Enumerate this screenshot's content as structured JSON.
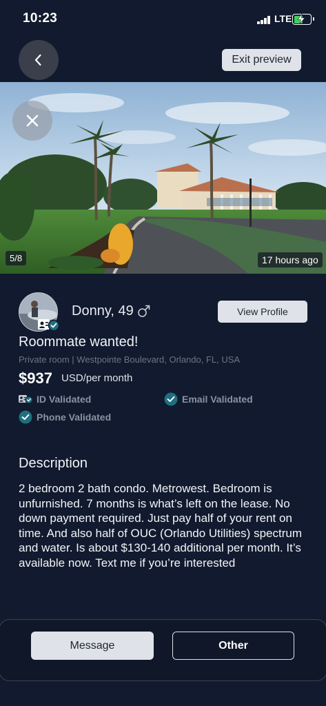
{
  "status_bar": {
    "time": "10:23",
    "network": "LTE",
    "battery_level": 0.55,
    "battery_color": "#3fd158"
  },
  "header": {
    "back_icon": "chevron-left-icon",
    "exit_label": "Exit preview"
  },
  "gallery": {
    "close_icon": "close-icon",
    "counter": "5/8",
    "time_ago": "17 hours ago"
  },
  "profile": {
    "name": "Donny, 49",
    "gender_icon": "male-icon",
    "view_profile_label": "View Profile"
  },
  "listing": {
    "title": "Roommate wanted!",
    "subtitle": "Private room | Westpointe Boulevard, Orlando, FL, USA",
    "price": "$937",
    "price_unit": "USD/per month"
  },
  "verifications": [
    {
      "label": "ID Validated",
      "icon": "id-card-check-icon"
    },
    {
      "label": "Email Validated",
      "icon": "check-circle-icon"
    },
    {
      "label": "Phone Validated",
      "icon": "check-circle-icon"
    }
  ],
  "description": {
    "heading": "Description",
    "body": "2 bedroom 2 bath condo. Metrowest. Bedroom is unfurnished. 7 months is what’s left on the lease. No down payment required. Just pay half of your rent on time. And also half of OUC (Orlando Utilities) spectrum and water. Is about $130-140 additional per month. It’s available now. Text me if you’re interested"
  },
  "actions": {
    "message_label": "Message",
    "other_label": "Other"
  },
  "colors": {
    "background": "#111a2e",
    "accent_teal": "#1f6f80",
    "button_light": "#dfe2e8"
  }
}
